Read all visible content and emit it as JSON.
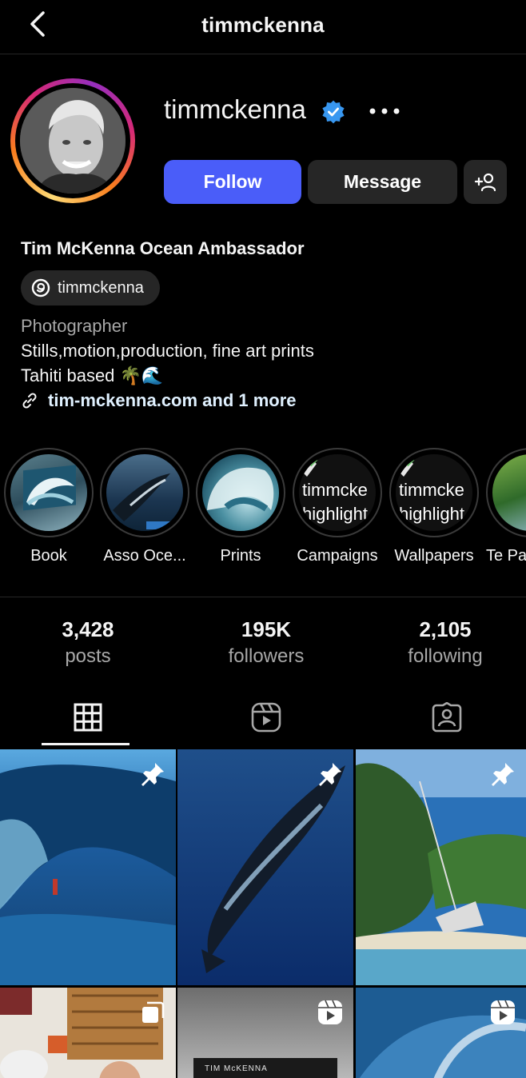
{
  "header": {
    "title": "timmckenna"
  },
  "profile": {
    "username": "timmckenna",
    "display_name": "Tim McKenna Ocean Ambassador",
    "threads_handle": "timmckenna",
    "category": "Photographer",
    "bio_line1": "Stills,motion,production, fine art prints",
    "bio_line2": "Tahiti based 🌴🌊",
    "link_text": "tim-mckenna.com and 1 more",
    "follow_label": "Follow",
    "message_label": "Message"
  },
  "highlights": [
    {
      "label": "Book"
    },
    {
      "label": "Asso Oce..."
    },
    {
      "label": "Prints"
    },
    {
      "label": "Campaigns",
      "cover_text": [
        "timmcke",
        "highlight"
      ]
    },
    {
      "label": "Wallpapers",
      "cover_text": [
        "timmcke",
        "highlight"
      ]
    },
    {
      "label": "Te Pa"
    }
  ],
  "stats": [
    {
      "value": "3,428",
      "label": "posts"
    },
    {
      "value": "195K",
      "label": "followers"
    },
    {
      "value": "2,105",
      "label": "following"
    }
  ],
  "tabs": [
    {
      "name": "posts-grid",
      "icon": "grid-icon"
    },
    {
      "name": "reels",
      "icon": "reels-icon"
    },
    {
      "name": "tagged",
      "icon": "tagged-icon"
    }
  ],
  "posts": [
    {
      "kind": "pinned",
      "icon": "pin-icon"
    },
    {
      "kind": "pinned",
      "icon": "pin-icon"
    },
    {
      "kind": "pinned",
      "icon": "pin-icon"
    },
    {
      "kind": "carousel",
      "icon": "carousel-icon"
    },
    {
      "kind": "reel",
      "icon": "reel-icon",
      "caption": "TIM McKENNA"
    },
    {
      "kind": "reel",
      "icon": "reel-icon"
    }
  ],
  "colors": {
    "accent": "#4a5df9",
    "verified": "#3897f0",
    "background": "#000000",
    "secondary_text": "#a8a8a8"
  }
}
